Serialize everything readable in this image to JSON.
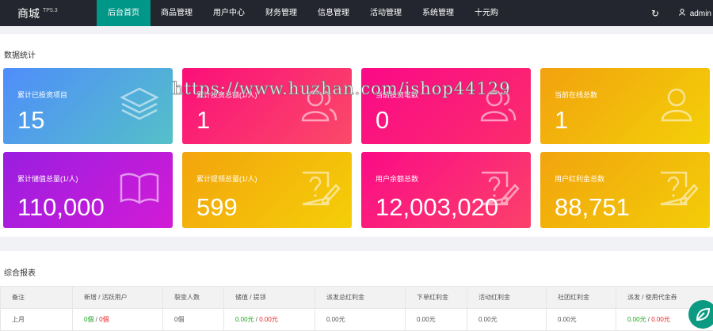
{
  "brand": {
    "name": "商城",
    "version": "TP5.3"
  },
  "nav": [
    {
      "label": "后台首页",
      "active": true
    },
    {
      "label": "商品管理"
    },
    {
      "label": "用户中心"
    },
    {
      "label": "财务管理"
    },
    {
      "label": "信息管理"
    },
    {
      "label": "活动管理"
    },
    {
      "label": "系统管理"
    },
    {
      "label": "十元购"
    }
  ],
  "header": {
    "refresh_icon": "↻",
    "user_icon": "user-icon",
    "user_name": "admin"
  },
  "stats": {
    "title": "数据统计",
    "cards": [
      {
        "label": "累计已投资项目",
        "value": "15",
        "icon": "layers-icon",
        "color": "#4f8dfb"
      },
      {
        "label": "累计投资总额(1/人)",
        "value": "1",
        "icon": "users-icon",
        "color": "#fb0f7a"
      },
      {
        "label": "当前投资笔数",
        "value": "0",
        "icon": "users-icon",
        "color": "#fb0a88"
      },
      {
        "label": "当前在线总数",
        "value": "1",
        "icon": "user-icon",
        "color": "#f2a20e"
      },
      {
        "label": "累计储值总量(1/人)",
        "value": "110,000",
        "icon": "book-icon",
        "color": "#9a1ee0"
      },
      {
        "label": "累计提领总量(1/人)",
        "value": "599",
        "icon": "question-note-icon",
        "color": "#f3a40d"
      },
      {
        "label": "用户余额总数",
        "value": "12,003,020",
        "icon": "question-note-icon",
        "color": "#fb0b86"
      },
      {
        "label": "用户红利金总数",
        "value": "88,751",
        "icon": "question-note-icon",
        "color": "#f2a40e"
      }
    ]
  },
  "watermark": "https://www.huzhan.com/ishop44129",
  "report": {
    "title": "综合报表",
    "columns": [
      "备注",
      "新增 / 活跃用户",
      "裂变人数",
      "储值 / 提领",
      "派发总红利金",
      "下单红利金",
      "活动红利金",
      "社团红利金",
      "派发 / 使用代金券"
    ],
    "rows": [
      {
        "note": "上月",
        "users_new": "0個",
        "users_active": "0個",
        "fission": "0個",
        "deposit": "0.00元",
        "withdraw": "0.00元",
        "total_bonus": "0.00元",
        "order_bonus": "0.00元",
        "activity_bonus": "0.00元",
        "club_bonus": "0.00元",
        "voucher_issued": "0.00元",
        "voucher_used": "0.00元"
      }
    ]
  },
  "float_button": {
    "icon": "leaf-icon"
  }
}
